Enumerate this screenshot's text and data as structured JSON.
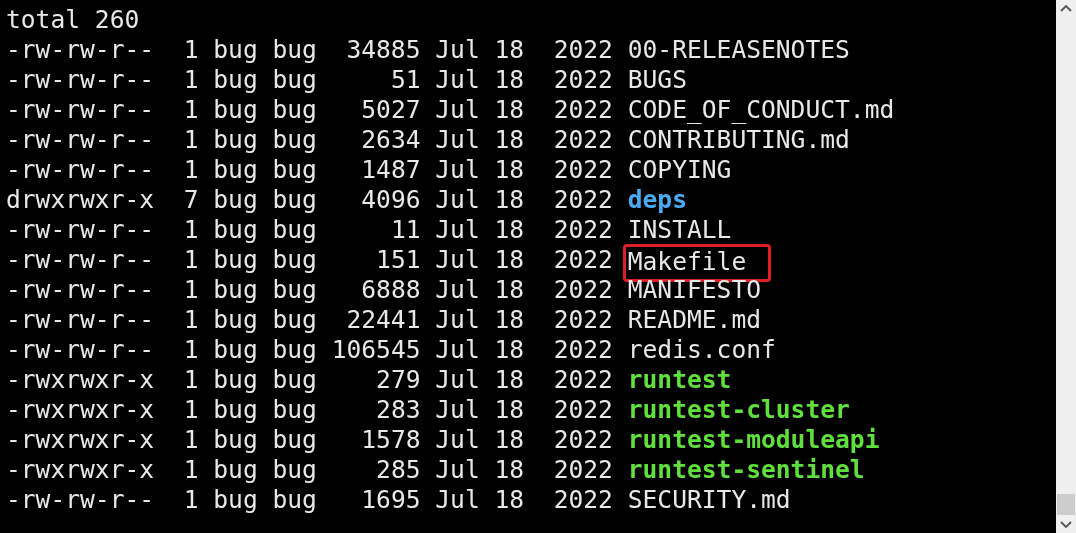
{
  "terminal": {
    "summary": "total 260",
    "rows": [
      {
        "permissions": "-rw-rw-r--",
        "links": "1",
        "owner": "bug",
        "group": "bug",
        "size": "34885",
        "month": "Jul",
        "day": "18",
        "year": "2022",
        "name": "00-RELEASENOTES",
        "kind": "file",
        "highlighted": false
      },
      {
        "permissions": "-rw-rw-r--",
        "links": "1",
        "owner": "bug",
        "group": "bug",
        "size": "51",
        "month": "Jul",
        "day": "18",
        "year": "2022",
        "name": "BUGS",
        "kind": "file",
        "highlighted": false
      },
      {
        "permissions": "-rw-rw-r--",
        "links": "1",
        "owner": "bug",
        "group": "bug",
        "size": "5027",
        "month": "Jul",
        "day": "18",
        "year": "2022",
        "name": "CODE_OF_CONDUCT.md",
        "kind": "file",
        "highlighted": false
      },
      {
        "permissions": "-rw-rw-r--",
        "links": "1",
        "owner": "bug",
        "group": "bug",
        "size": "2634",
        "month": "Jul",
        "day": "18",
        "year": "2022",
        "name": "CONTRIBUTING.md",
        "kind": "file",
        "highlighted": false
      },
      {
        "permissions": "-rw-rw-r--",
        "links": "1",
        "owner": "bug",
        "group": "bug",
        "size": "1487",
        "month": "Jul",
        "day": "18",
        "year": "2022",
        "name": "COPYING",
        "kind": "file",
        "highlighted": false
      },
      {
        "permissions": "drwxrwxr-x",
        "links": "7",
        "owner": "bug",
        "group": "bug",
        "size": "4096",
        "month": "Jul",
        "day": "18",
        "year": "2022",
        "name": "deps",
        "kind": "directory",
        "highlighted": false
      },
      {
        "permissions": "-rw-rw-r--",
        "links": "1",
        "owner": "bug",
        "group": "bug",
        "size": "11",
        "month": "Jul",
        "day": "18",
        "year": "2022",
        "name": "INSTALL",
        "kind": "file",
        "highlighted": false
      },
      {
        "permissions": "-rw-rw-r--",
        "links": "1",
        "owner": "bug",
        "group": "bug",
        "size": "151",
        "month": "Jul",
        "day": "18",
        "year": "2022",
        "name": "Makefile",
        "kind": "file",
        "highlighted": true
      },
      {
        "permissions": "-rw-rw-r--",
        "links": "1",
        "owner": "bug",
        "group": "bug",
        "size": "6888",
        "month": "Jul",
        "day": "18",
        "year": "2022",
        "name": "MANIFESTO",
        "kind": "file",
        "highlighted": false
      },
      {
        "permissions": "-rw-rw-r--",
        "links": "1",
        "owner": "bug",
        "group": "bug",
        "size": "22441",
        "month": "Jul",
        "day": "18",
        "year": "2022",
        "name": "README.md",
        "kind": "file",
        "highlighted": false
      },
      {
        "permissions": "-rw-rw-r--",
        "links": "1",
        "owner": "bug",
        "group": "bug",
        "size": "106545",
        "month": "Jul",
        "day": "18",
        "year": "2022",
        "name": "redis.conf",
        "kind": "file",
        "highlighted": false
      },
      {
        "permissions": "-rwxrwxr-x",
        "links": "1",
        "owner": "bug",
        "group": "bug",
        "size": "279",
        "month": "Jul",
        "day": "18",
        "year": "2022",
        "name": "runtest",
        "kind": "executable",
        "highlighted": false
      },
      {
        "permissions": "-rwxrwxr-x",
        "links": "1",
        "owner": "bug",
        "group": "bug",
        "size": "283",
        "month": "Jul",
        "day": "18",
        "year": "2022",
        "name": "runtest-cluster",
        "kind": "executable",
        "highlighted": false
      },
      {
        "permissions": "-rwxrwxr-x",
        "links": "1",
        "owner": "bug",
        "group": "bug",
        "size": "1578",
        "month": "Jul",
        "day": "18",
        "year": "2022",
        "name": "runtest-moduleapi",
        "kind": "executable",
        "highlighted": false
      },
      {
        "permissions": "-rwxrwxr-x",
        "links": "1",
        "owner": "bug",
        "group": "bug",
        "size": "285",
        "month": "Jul",
        "day": "18",
        "year": "2022",
        "name": "runtest-sentinel",
        "kind": "executable",
        "highlighted": false
      },
      {
        "permissions": "-rw-rw-r--",
        "links": "1",
        "owner": "bug",
        "group": "bug",
        "size": "1695",
        "month": "Jul",
        "day": "18",
        "year": "2022",
        "name": "SECURITY.md",
        "kind": "file",
        "highlighted": false
      }
    ]
  }
}
